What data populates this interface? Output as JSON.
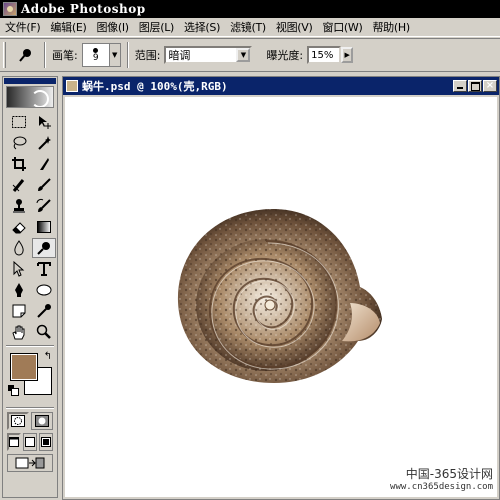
{
  "app": {
    "title": "Adobe Photoshop"
  },
  "menu": [
    "文件(F)",
    "编辑(E)",
    "图像(I)",
    "图层(L)",
    "选择(S)",
    "滤镜(T)",
    "视图(V)",
    "窗口(W)",
    "帮助(H)"
  ],
  "options": {
    "brush_label": "画笔:",
    "brush_size": "9",
    "range_label": "范围:",
    "range_value": "暗调",
    "exposure_label": "曝光度:",
    "exposure_value": "15%"
  },
  "toolbox": {
    "tools": [
      "rect-marquee",
      "move",
      "lasso",
      "magic-wand",
      "crop",
      "slice",
      "healing-brush",
      "brush",
      "clone-stamp",
      "history-brush",
      "eraser",
      "gradient",
      "blur",
      "burn",
      "path-selection",
      "type",
      "pen",
      "ellipse",
      "notes",
      "eyedropper",
      "hand",
      "zoom"
    ],
    "active_tool": "burn",
    "foreground_color": "#a07b57",
    "background_color": "#ffffff"
  },
  "document": {
    "title": "蜗牛.psd @ 100%(壳,RGB)"
  },
  "watermark": {
    "line1": "中国-365设计网",
    "line2": "www.cn365design.com"
  },
  "colors": {
    "titlebar": "#000000",
    "doc_titlebar": "#0a246a",
    "chrome": "#d4d0c8"
  }
}
